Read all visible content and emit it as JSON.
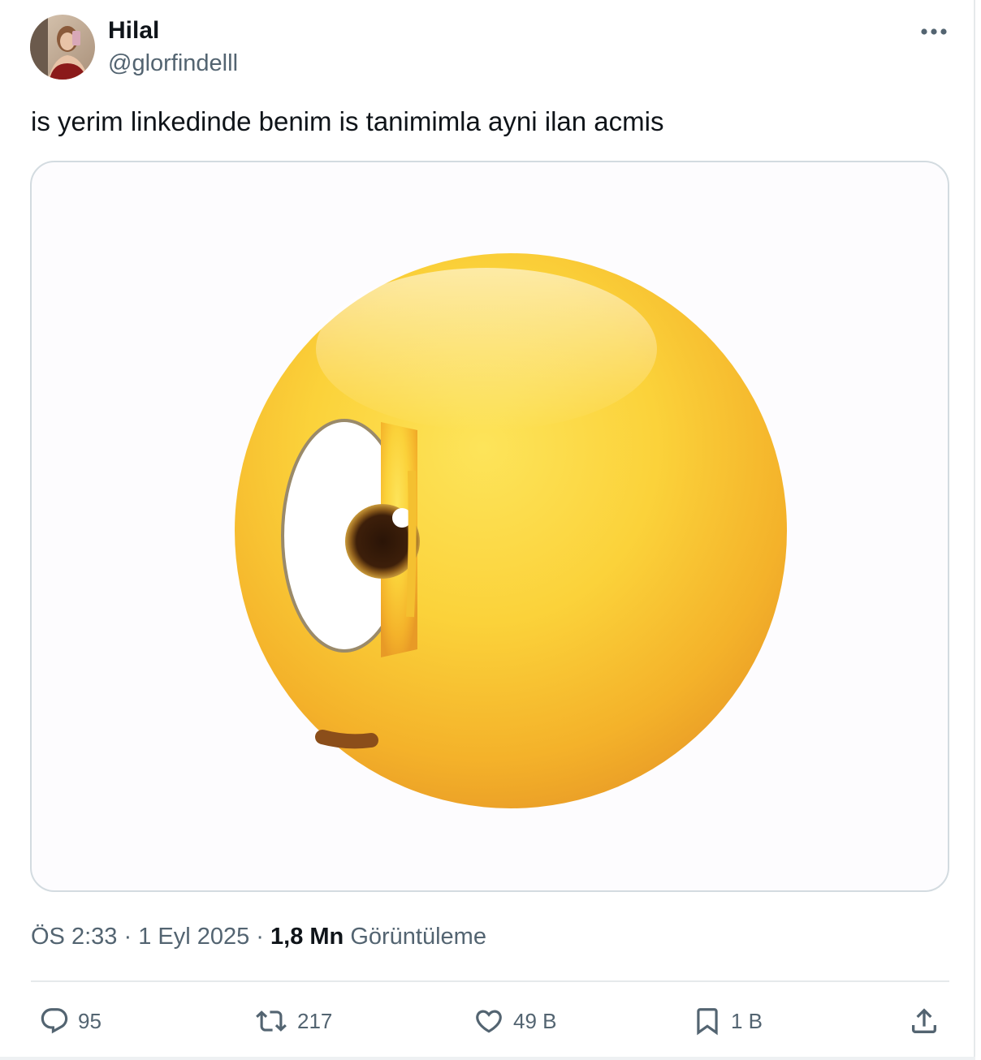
{
  "author": {
    "display_name": "Hilal",
    "handle": "@glorfindelll"
  },
  "more_icon": "more-horizontal-icon",
  "tweet_text": "is yerim linkedinde benim is tanimimla ayni ilan acmis",
  "media": {
    "icon": "face-with-peeking-eye-emoji"
  },
  "meta": {
    "time": "ÖS 2:33",
    "separator_1": " · ",
    "date": "1 Eyl 2025",
    "separator_2": " · ",
    "views_count": "1,8 Mn",
    "views_label": " Görüntüleme"
  },
  "actions": {
    "reply": {
      "icon": "reply-icon",
      "count": "95"
    },
    "repost": {
      "icon": "repost-icon",
      "count": "217"
    },
    "like": {
      "icon": "heart-icon",
      "count": "49 B"
    },
    "bookmark": {
      "icon": "bookmark-icon",
      "count": "1 B"
    },
    "share": {
      "icon": "share-icon"
    }
  },
  "colors": {
    "text": "#0f1419",
    "secondary": "#536471",
    "border": "#d3dbe0",
    "emoji_yellow": "#f7c12c"
  }
}
